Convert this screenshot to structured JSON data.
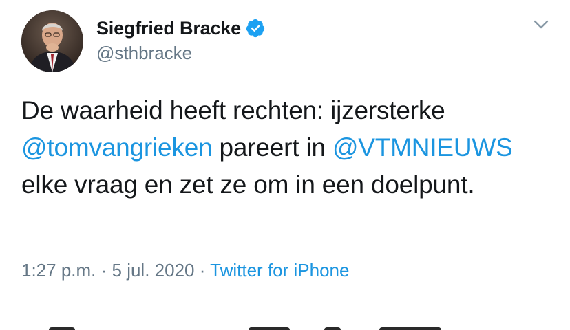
{
  "user": {
    "display_name": "Siegfried Bracke",
    "handle": "@sthbracke",
    "verified": true
  },
  "tweet": {
    "text_part1": "De waarheid heeft rechten: ijzersterke ",
    "mention1": "@tomvangrieken",
    "text_part2": " pareert in ",
    "mention2": "@VTMNIEUWS",
    "text_part3": " elke vraag en zet ze om in een doelpunt."
  },
  "meta": {
    "time": "1:27 p.m.",
    "separator": " · ",
    "date": "5 jul. 2020",
    "source": "Twitter for iPhone"
  },
  "colors": {
    "link": "#1b95e0",
    "secondary_text": "#657786",
    "primary_text": "#14171a",
    "divider": "#e6ecf0"
  },
  "icons": {
    "verified": "verified-badge-icon",
    "menu": "chevron-down-icon"
  }
}
